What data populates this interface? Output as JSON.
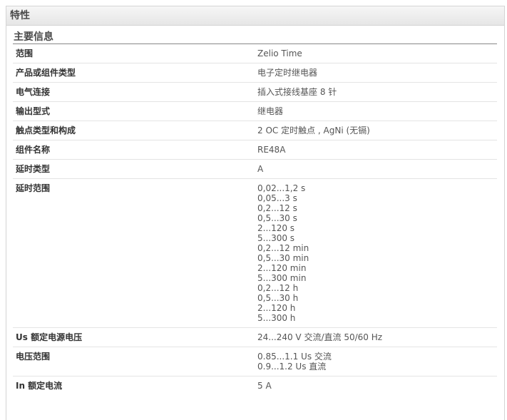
{
  "header": {
    "title": "特性"
  },
  "section": {
    "title": "主要信息"
  },
  "rows": [
    {
      "label": "范围",
      "values": [
        "Zelio Time"
      ]
    },
    {
      "label": "产品或组件类型",
      "values": [
        "电子定时继电器"
      ]
    },
    {
      "label": "电气连接",
      "values": [
        "插入式接线基座 8 针"
      ]
    },
    {
      "label": "输出型式",
      "values": [
        "继电器"
      ]
    },
    {
      "label": "触点类型和构成",
      "values": [
        "2 OC 定时触点 , AgNi (无镉)"
      ]
    },
    {
      "label": "组件名称",
      "values": [
        "RE48A"
      ]
    },
    {
      "label": "延时类型",
      "values": [
        "A"
      ]
    },
    {
      "label": "延时范围",
      "values": [
        "0,02...1,2 s",
        "0,05...3 s",
        "0,2...12 s",
        "0,5...30 s",
        "2...120 s",
        "5...300 s",
        "0,2...12 min",
        "0,5...30 min",
        "2...120 min",
        "5...300 min",
        "0,2...12 h",
        "0,5...30 h",
        "2...120 h",
        "5...300 h"
      ]
    },
    {
      "label": "Us 额定电源电压",
      "values": [
        "24...240 V 交流/直流 50/60 Hz"
      ]
    },
    {
      "label": "电压范围",
      "values": [
        "0.85...1.1 Us 交流",
        "0.9...1.2 Us 直流"
      ]
    },
    {
      "label": "In 额定电流",
      "values": [
        "5 A"
      ]
    }
  ]
}
